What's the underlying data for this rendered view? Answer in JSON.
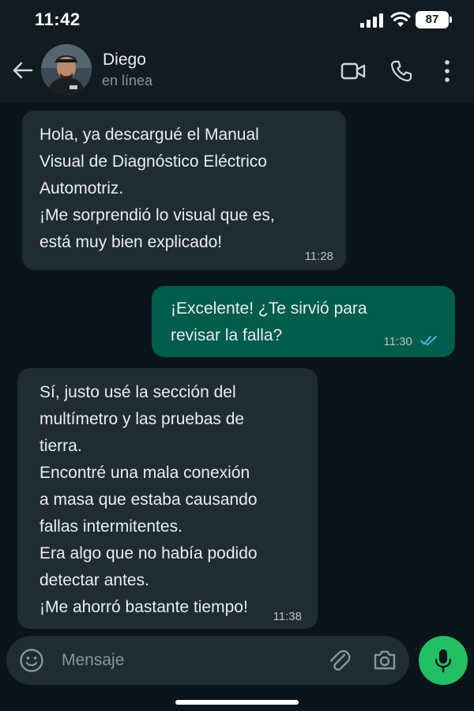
{
  "status_bar": {
    "time": "11:42",
    "battery": "87"
  },
  "header": {
    "name": "Diego",
    "status": "en línea"
  },
  "messages": [
    {
      "direction": "incoming",
      "text": "Hola, ya descargué el Manual\nVisual de Diagnóstico Eléctrico\nAutomotriz.\n¡Me sorprendió lo visual que es,\nestá muy bien explicado!",
      "time": "11:28"
    },
    {
      "direction": "outgoing",
      "text": "¡Excelente! ¿Te sirvió para\nrevisar la falla?",
      "time": "11:30",
      "read": true
    },
    {
      "direction": "incoming",
      "text": "Sí, justo usé la sección del\nmultímetro y las pruebas de\ntierra.\nEncontré una mala conexión\na masa que estaba causando\nfallas intermitentes.\nEra algo que no había podido\ndetectar antes.\n¡Me ahorró bastante tiempo!",
      "time": "11:38"
    }
  ],
  "composer": {
    "placeholder": "Mensaje"
  },
  "icons": {
    "back": "arrow-left-icon",
    "video": "video-camera-icon",
    "call": "phone-icon",
    "menu": "more-vertical-icon",
    "emoji": "emoji-icon",
    "attach": "paperclip-icon",
    "camera": "camera-icon",
    "mic": "microphone-icon",
    "read_receipt": "double-check-icon"
  },
  "colors": {
    "background": "#0b141a",
    "header": "#121b22",
    "incoming_bubble": "#202c33",
    "outgoing_bubble": "#005c4b",
    "accent": "#21c063",
    "read_ticks": "#53bdeb"
  }
}
